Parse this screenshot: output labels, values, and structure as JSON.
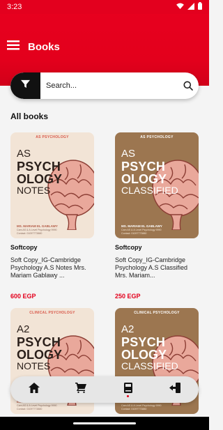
{
  "status_bar": {
    "time": "3:23"
  },
  "header": {
    "title": "Books"
  },
  "search": {
    "placeholder": "Search..."
  },
  "section": {
    "title": "All books"
  },
  "books": [
    {
      "cover": {
        "category": "AS PSYCHOLOGY",
        "line1": "AS",
        "line2": "PSYCH",
        "line3": "OLOGY",
        "line4": "NOTES",
        "author": "MS. MARIAM EL GABLAWY",
        "subtitle": "Cam AS & A Level Psychology 9990",
        "contact": "Contact: 01097773880"
      },
      "format": "Softcopy",
      "description": "Soft Copy_IG-Cambridge Psychology A.S Notes Mrs. Mariam Gablawy ...",
      "price": "600 EGP"
    },
    {
      "cover": {
        "category": "AS PSYCHOLOGY",
        "line1": "AS",
        "line2": "PSYCH",
        "line3": "OLOGY",
        "line4": "CLASSIFIED",
        "author": "MS. MARIAM EL GABLAWY",
        "subtitle": "Cam AS & A Level Psychology 9990",
        "contact": "Contact: 01097773880"
      },
      "format": "Softcopy",
      "description": "Soft Copy_IG-Cambridge Psychology A.S Classified Mrs. Mariam...",
      "price": "250 EGP"
    },
    {
      "cover": {
        "category": "CLINICAL PSYCHOLOGY",
        "line1": "A2",
        "line2": "PSYCH",
        "line3": "OLOGY",
        "line4": "NOTES",
        "author": "MS. MARIAM EL GABLAWY",
        "subtitle": "Cam AS & A Level Psychology 9990",
        "contact": "Contact: 01097773880"
      }
    },
    {
      "cover": {
        "category": "CLINICAL PSYCHOLOGY",
        "line1": "A2",
        "line2": "PSYCH",
        "line3": "OLOGY",
        "line4": "CLASSIFIED",
        "author": "MS. MARIAM EL GABLAWY",
        "subtitle": "Cam AS & A Level Psychology 9990",
        "contact": "Contact: 01097773880"
      }
    }
  ],
  "nav": {
    "items": [
      {
        "icon": "home-icon"
      },
      {
        "icon": "cart-icon"
      },
      {
        "icon": "book-icon",
        "active": true
      },
      {
        "icon": "logout-icon"
      }
    ]
  },
  "colors": {
    "brand": "#e3001c",
    "cover_light": "#f2e4d6",
    "cover_dark": "#9c7650"
  }
}
